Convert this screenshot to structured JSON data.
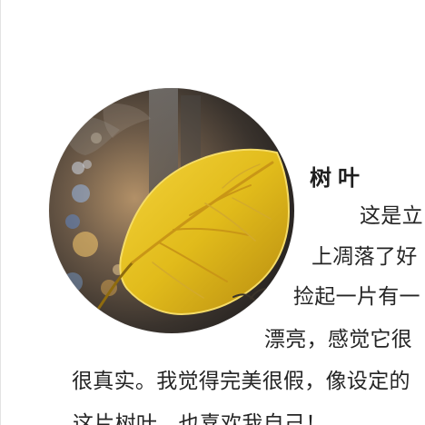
{
  "article": {
    "title": "树叶",
    "lines": [
      "这是立",
      "上凋落了好",
      "捡起一片有一",
      "漂亮，感觉它很",
      "很真实。我觉得完美很假，像设定的",
      "这片树叶，也喜欢我自己！"
    ]
  },
  "image": {
    "subject": "yellow-leaf-photo",
    "colors": {
      "leaf": "#e8c21f",
      "leaf_shadow": "#b88d12",
      "background_dark": "#2b2723",
      "background_warm": "#8e7456",
      "background_blue": "#5d7ea6"
    }
  }
}
